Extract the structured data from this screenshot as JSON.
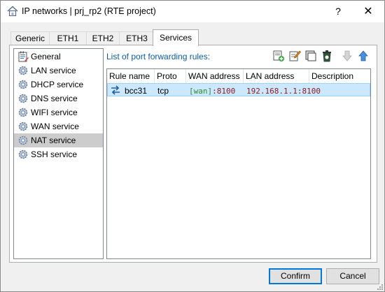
{
  "window": {
    "title": "IP networks | prj_rp2 (RTE project)",
    "help_label": "?",
    "close_label": "✕"
  },
  "tabs": [
    {
      "label": "Generic"
    },
    {
      "label": "ETH1"
    },
    {
      "label": "ETH2"
    },
    {
      "label": "ETH3"
    },
    {
      "label": "Services",
      "active": true
    }
  ],
  "sidebar": {
    "items": [
      {
        "label": "General",
        "icon": "notepad-icon"
      },
      {
        "label": "LAN service",
        "icon": "gear-icon"
      },
      {
        "label": "DHCP service",
        "icon": "gear-icon"
      },
      {
        "label": "DNS service",
        "icon": "gear-icon"
      },
      {
        "label": "WIFI service",
        "icon": "gear-icon"
      },
      {
        "label": "WAN service",
        "icon": "gear-icon"
      },
      {
        "label": "NAT service",
        "icon": "gear-icon",
        "selected": true
      },
      {
        "label": "SSH service",
        "icon": "gear-icon"
      }
    ]
  },
  "main": {
    "list_label": "List of port forwarding rules:",
    "toolbar": [
      "add-rule-icon",
      "edit-rule-icon",
      "copy-rule-icon",
      "delete-rule-icon",
      "move-down-icon",
      "move-up-icon"
    ],
    "table": {
      "columns": [
        "Rule name",
        "Proto",
        "WAN address",
        "LAN address",
        "Description"
      ],
      "rows": [
        {
          "name": "bcc31",
          "proto": "tcp",
          "wan_iface": "[wan]",
          "wan_port": ":8100",
          "lan": "192.168.1.1:8100",
          "description": ""
        }
      ]
    }
  },
  "buttons": {
    "confirm": "Confirm",
    "cancel": "Cancel"
  },
  "colors": {
    "accent": "#0078d7",
    "list_label": "#0a5aa8",
    "selection": "#cce8ff",
    "wan_iface": "#2e8b2e",
    "lan_address": "#8b1a1a"
  }
}
